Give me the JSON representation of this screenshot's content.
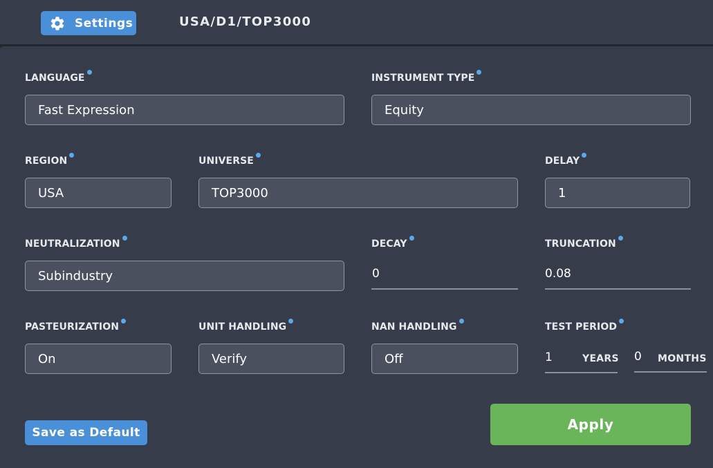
{
  "header": {
    "settings_icon": "gear-icon",
    "settings_label": "Settings",
    "breadcrumb": "USA/D1/TOP3000"
  },
  "fields": {
    "language": {
      "label": "LANGUAGE",
      "value": "Fast Expression"
    },
    "instrument_type": {
      "label": "INSTRUMENT TYPE",
      "value": "Equity"
    },
    "region": {
      "label": "REGION",
      "value": "USA"
    },
    "universe": {
      "label": "UNIVERSE",
      "value": "TOP3000"
    },
    "delay": {
      "label": "DELAY",
      "value": "1"
    },
    "neutralization": {
      "label": "NEUTRALIZATION",
      "value": "Subindustry"
    },
    "decay": {
      "label": "DECAY",
      "value": "0"
    },
    "truncation": {
      "label": "TRUNCATION",
      "value": "0.08"
    },
    "pasteurization": {
      "label": "PASTEURIZATION",
      "value": "On"
    },
    "unit_handling": {
      "label": "UNIT HANDLING",
      "value": "Verify"
    },
    "nan_handling": {
      "label": "NAN HANDLING",
      "value": "Off"
    },
    "test_period": {
      "label": "TEST PERIOD",
      "years_value": "1",
      "years_unit": "YEARS",
      "months_value": "0",
      "months_unit": "MONTHS"
    }
  },
  "actions": {
    "save_default_label": "Save as Default",
    "apply_label": "Apply"
  },
  "colors": {
    "background": "#363c49",
    "accent_blue": "#4a90d9",
    "apply_green": "#6ab55a",
    "info_dot": "#5aa9ee"
  }
}
